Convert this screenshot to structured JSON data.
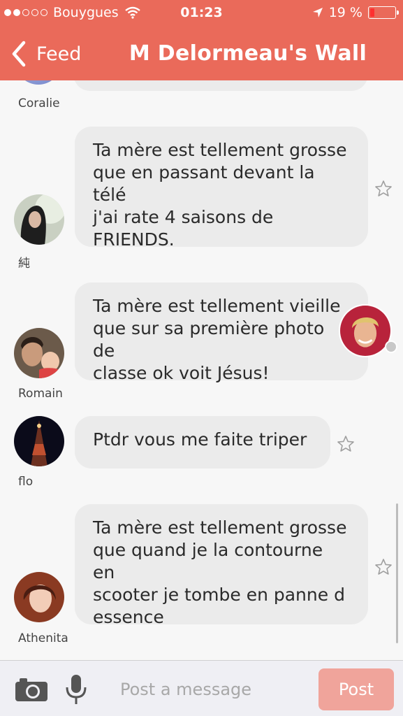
{
  "status_bar": {
    "carrier": "Bouygues",
    "time": "01:23",
    "battery": "19 %"
  },
  "nav": {
    "back_label": "Feed",
    "title": "M Delormeau's Wall"
  },
  "feed": {
    "messages": [
      {
        "author": "Coralie",
        "text": ""
      },
      {
        "author": "純",
        "text": "Ta mère est tellement grosse\nque en passant devant la télé\nj'ai rate 4 saisons de\nFRIENDS."
      },
      {
        "author": "Romain",
        "text": "Ta mère est tellement vieille\nque sur sa première photo de\nclasse ok voit Jésus!"
      },
      {
        "author": "flo",
        "text": "Ptdr vous me faite triper"
      },
      {
        "author": "Athenita",
        "text": "Ta mère est tellement grosse\nque quand je la contourne en\nscooter je tombe en panne d\nessence"
      }
    ]
  },
  "input": {
    "placeholder": "Post a message",
    "post_label": "Post"
  },
  "colors": {
    "accent": "#ea6a5a",
    "bubble": "#ebebeb",
    "post_button": "#f0a49b"
  }
}
